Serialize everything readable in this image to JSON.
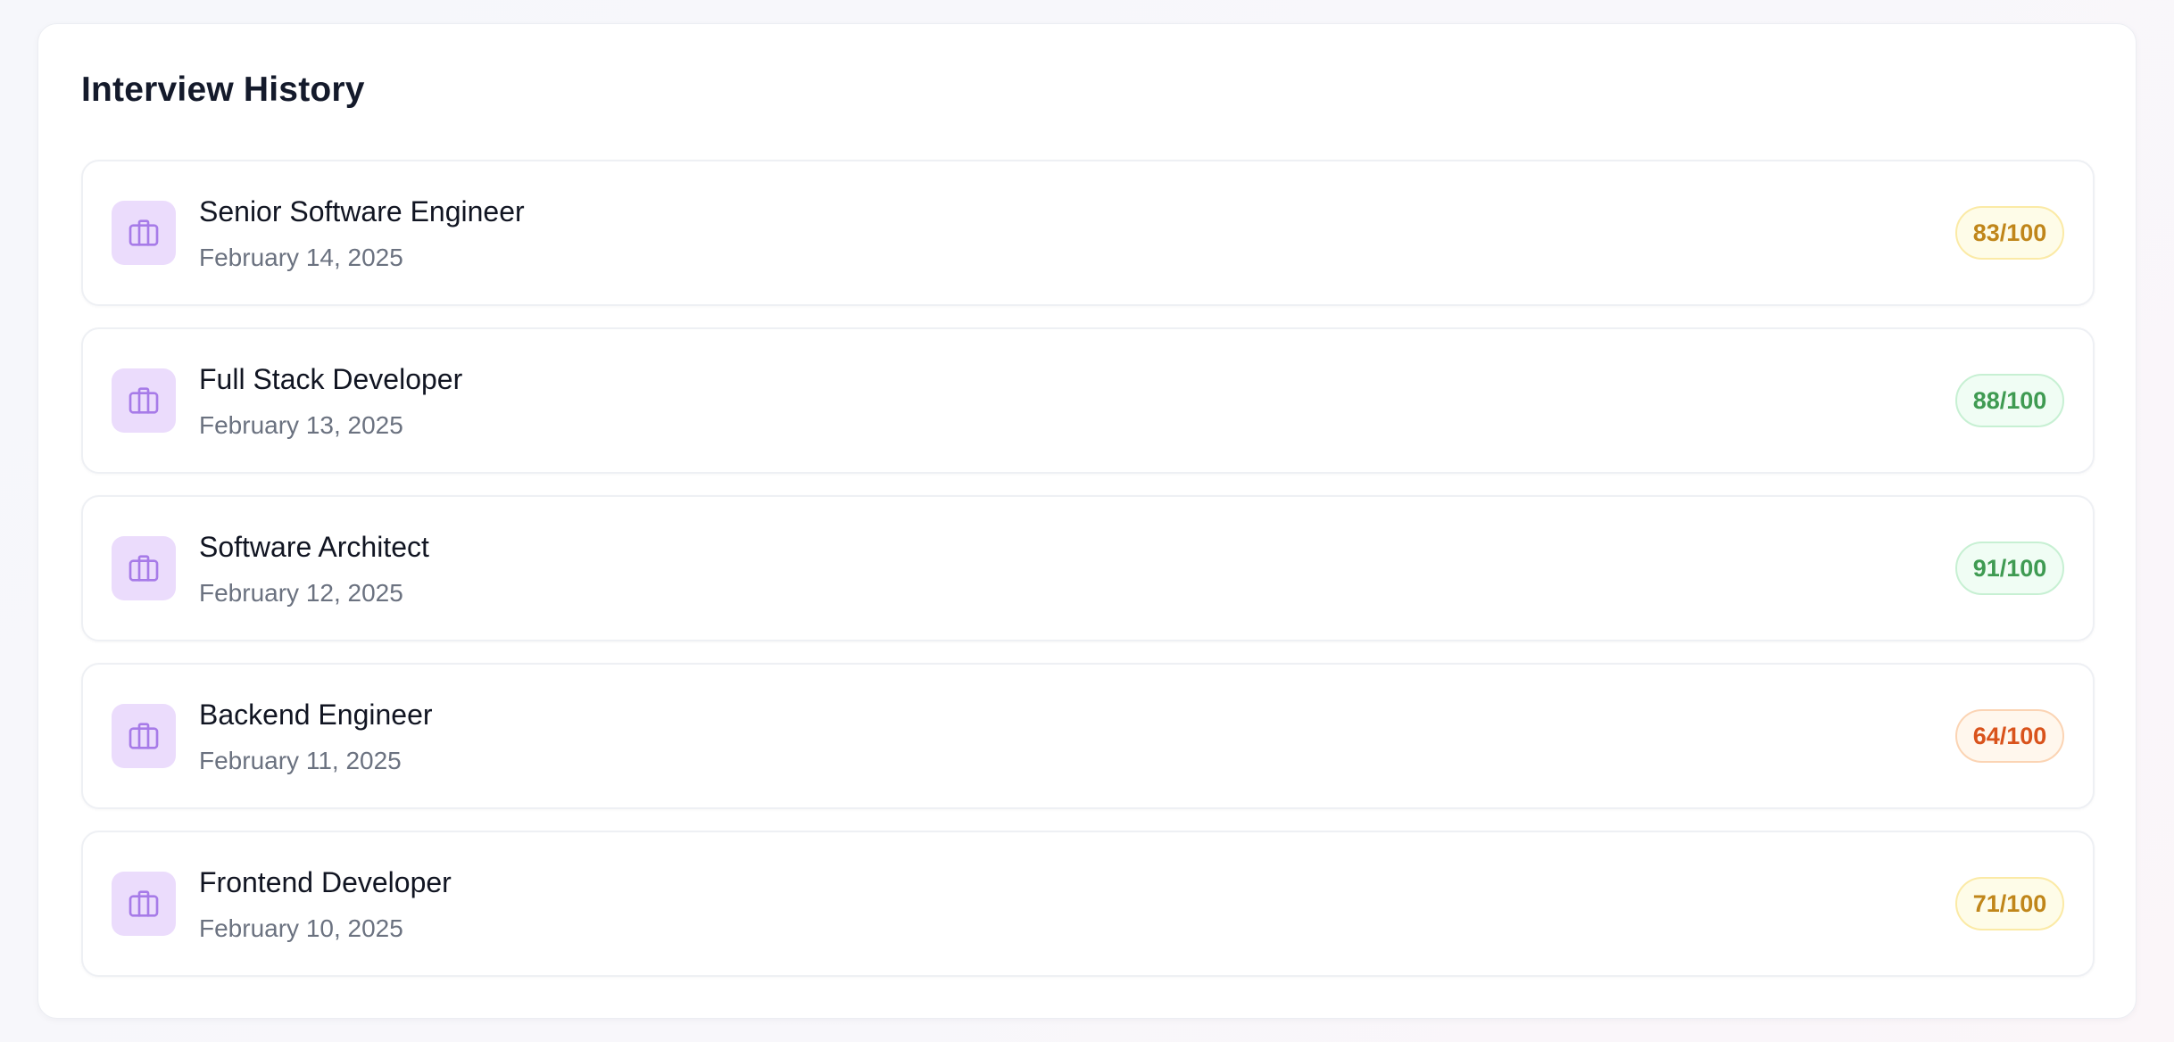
{
  "page": {
    "title": "Interview History"
  },
  "colors": {
    "icon_tile_bg": "#ebdcfc",
    "icon_stroke": "#a77be8",
    "score_yellow": "#c0861a",
    "score_green": "#3f9b52",
    "score_orange": "#d9531c"
  },
  "interviews": [
    {
      "role": "Senior Software Engineer",
      "date": "February 14, 2025",
      "score": "83/100",
      "score_tone": "yellow",
      "icon": "briefcase-icon"
    },
    {
      "role": "Full Stack Developer",
      "date": "February 13, 2025",
      "score": "88/100",
      "score_tone": "green",
      "icon": "briefcase-icon"
    },
    {
      "role": "Software Architect",
      "date": "February 12, 2025",
      "score": "91/100",
      "score_tone": "green",
      "icon": "briefcase-icon"
    },
    {
      "role": "Backend Engineer",
      "date": "February 11, 2025",
      "score": "64/100",
      "score_tone": "orange",
      "icon": "briefcase-icon"
    },
    {
      "role": "Frontend Developer",
      "date": "February 10, 2025",
      "score": "71/100",
      "score_tone": "yellow",
      "icon": "briefcase-icon"
    }
  ]
}
